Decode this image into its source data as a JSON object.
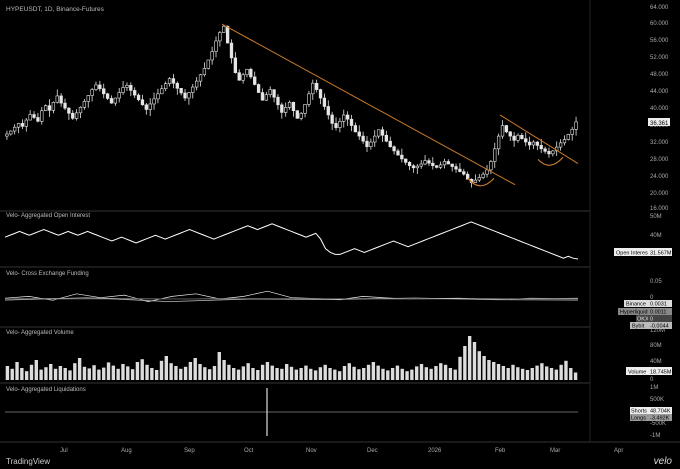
{
  "symbol_title": "HYPEUSDT, 1D, Binance-Futures",
  "panes": {
    "oi": {
      "title": "Velo- Aggregated Open Interest",
      "tag_label": "Open Interest",
      "tag_value": "31.567M"
    },
    "funding": {
      "title": "Velo- Cross Exchange Funding",
      "tags": [
        {
          "label": "Binance",
          "value": "0.0031"
        },
        {
          "label": "Hyperliquid",
          "value": "0.0011"
        },
        {
          "label": "OKX",
          "value": "0"
        },
        {
          "label": "Bybit",
          "value": "-0.0044"
        }
      ]
    },
    "volume": {
      "title": "Velo- Aggregated Volume",
      "tag_label": "Volume",
      "tag_value": "18.745M"
    },
    "liq": {
      "title": "Velo- Aggregated Liquidations",
      "tags": [
        {
          "label": "Shorts",
          "value": "48.704K"
        },
        {
          "label": "Longs",
          "value": "-3.492K"
        }
      ]
    }
  },
  "footer": {
    "brand": "TradingView",
    "velo": "velo"
  },
  "chart_data": {
    "type": "line",
    "subtype": "candlestick",
    "x_ticks": [
      "Jul",
      "Aug",
      "Sep",
      "Oct",
      "Nov",
      "Dec",
      "2026",
      "Feb",
      "Mar",
      "Apr"
    ],
    "price_axis": {
      "ticks": [
        "64.000",
        "60.000",
        "56.000",
        "52.000",
        "48.000",
        "44.000",
        "40.000",
        "36.000",
        "32.000",
        "28.000",
        "24.000",
        "20.000",
        "16.000"
      ],
      "ylim": [
        16,
        64
      ],
      "last_price": "36.361"
    },
    "oi_axis": {
      "ticks": [
        "50M",
        "40M"
      ]
    },
    "funding_axis": {
      "ticks": [
        "0.05",
        "0"
      ]
    },
    "volume_axis": {
      "ticks": [
        "120M",
        "80M",
        "40M",
        "0"
      ]
    },
    "liq_axis": {
      "ticks": [
        "1M",
        "500K",
        "0",
        "-500K",
        "-1M"
      ]
    },
    "price_close": [
      33.5,
      34.2,
      35.1,
      36.0,
      35.3,
      36.8,
      38.1,
      37.4,
      36.5,
      39.0,
      40.2,
      39.1,
      41.0,
      42.5,
      40.8,
      39.6,
      38.4,
      37.2,
      38.5,
      39.8,
      41.2,
      42.6,
      44.0,
      45.1,
      44.2,
      43.0,
      41.9,
      40.8,
      42.0,
      43.3,
      44.5,
      45.0,
      43.8,
      42.7,
      41.6,
      40.4,
      39.3,
      40.6,
      41.8,
      43.0,
      44.2,
      45.4,
      46.6,
      45.5,
      44.3,
      43.2,
      42.0,
      43.3,
      44.6,
      46.0,
      47.5,
      49.0,
      51.0,
      53.0,
      55.5,
      57.5,
      59.0,
      55.0,
      51.5,
      48.0,
      46.2,
      47.5,
      48.8,
      47.0,
      45.2,
      43.3,
      41.5,
      42.8,
      44.0,
      42.2,
      40.4,
      38.6,
      39.8,
      41.0,
      39.0,
      37.2,
      38.4,
      40.5,
      43.0,
      45.5,
      44.0,
      42.0,
      40.0,
      38.0,
      36.0,
      35.0,
      36.5,
      38.0,
      37.0,
      35.5,
      34.0,
      33.0,
      31.8,
      30.5,
      31.6,
      33.0,
      34.5,
      33.2,
      31.8,
      30.5,
      29.5,
      28.5,
      27.6,
      26.8,
      26.0,
      25.5,
      25.9,
      26.4,
      27.2,
      26.6,
      26.0,
      25.6,
      26.2,
      27.0,
      26.4,
      25.8,
      25.2,
      24.6,
      24.0,
      22.8,
      22.0,
      22.6,
      23.2,
      24.0,
      25.0,
      27.0,
      30.0,
      33.0,
      35.5,
      34.0,
      33.0,
      32.0,
      33.2,
      32.4,
      31.6,
      30.9,
      31.6,
      30.8,
      30.0,
      29.4,
      28.8,
      29.5,
      30.4,
      31.4,
      32.2,
      33.4,
      34.6,
      36.361
    ],
    "open_interest": [
      43,
      44,
      45,
      46,
      45,
      44,
      45,
      46,
      47,
      46,
      45,
      44,
      45,
      46,
      45,
      44,
      45,
      46,
      45,
      44,
      43,
      42,
      41,
      42,
      43,
      42,
      41,
      40,
      41,
      42,
      43,
      44,
      43,
      42,
      43,
      44,
      45,
      46,
      47,
      46,
      45,
      44,
      43,
      42,
      43,
      44,
      45,
      46,
      47,
      48,
      49,
      48,
      47,
      48,
      49,
      50,
      49,
      48,
      47,
      46,
      45,
      44,
      43,
      44,
      45,
      42,
      37,
      35,
      34,
      34,
      35,
      36,
      37,
      36,
      35,
      36,
      37,
      38,
      39,
      40,
      41,
      40,
      39,
      38,
      39,
      40,
      41,
      42,
      43,
      44,
      45,
      46,
      47,
      48,
      49,
      50,
      51,
      50,
      49,
      48,
      47,
      46,
      45,
      44,
      43,
      42,
      41,
      40,
      39,
      38,
      37,
      36,
      35,
      34,
      33,
      32,
      33,
      32,
      31.567
    ],
    "funding": {
      "binance": [
        0.0031,
        0.01,
        -0.005,
        0.02,
        0.005,
        0.015,
        -0.01,
        0.01,
        0.02,
        0.0,
        0.01,
        0.03,
        0.005,
        0.002,
        -0.003,
        0.01,
        0.004,
        0.0,
        0.002,
        0.003,
        0.001,
        -0.002,
        0.003,
        0.002,
        0.0031
      ],
      "hyperliquid": [
        0.0011,
        0.002,
        0.001,
        0.003,
        0.002,
        0.001,
        0.0,
        0.002,
        0.001,
        0.001,
        0.002,
        0.001,
        0.001,
        0.0,
        0.001,
        0.001,
        0.002,
        0.001,
        0.001,
        0.0011
      ],
      "okx": [
        0
      ],
      "bybit": [
        -0.0044,
        0.005,
        -0.01,
        0.0,
        -0.002,
        0.004,
        -0.003,
        -0.0044
      ]
    },
    "volume": [
      35,
      28,
      45,
      30,
      22,
      38,
      50,
      26,
      32,
      40,
      28,
      35,
      30,
      24,
      42,
      55,
      33,
      29,
      37,
      26,
      31,
      44,
      36,
      28,
      40,
      34,
      27,
      45,
      52,
      38,
      30,
      25,
      48,
      60,
      42,
      35,
      28,
      33,
      45,
      55,
      40,
      32,
      27,
      35,
      70,
      50,
      38,
      30,
      26,
      34,
      42,
      30,
      25,
      38,
      45,
      36,
      30,
      28,
      40,
      33,
      26,
      30,
      36,
      28,
      24,
      32,
      38,
      30,
      26,
      22,
      35,
      42,
      33,
      27,
      30,
      38,
      45,
      36,
      28,
      24,
      30,
      36,
      28,
      22,
      26,
      34,
      40,
      32,
      28,
      35,
      42,
      38,
      30,
      26,
      58,
      85,
      110,
      95,
      72,
      60,
      50,
      45,
      40,
      35,
      30,
      38,
      32,
      28,
      25,
      30,
      36,
      42,
      34,
      30,
      26,
      38,
      48,
      30,
      18.745
    ],
    "liquidations": {
      "spike_max": 1000,
      "spike_min": -1000,
      "shorts": "48.704K",
      "longs": "-3.492K"
    },
    "trendline_desc": "falling resistance from Sep high into late Jan",
    "colors": {
      "candle": "#e6e6e6",
      "trendline": "#c87a2a",
      "oi_line": "#ffffff",
      "volume_bar": "#dddddd",
      "background": "#000000"
    }
  }
}
